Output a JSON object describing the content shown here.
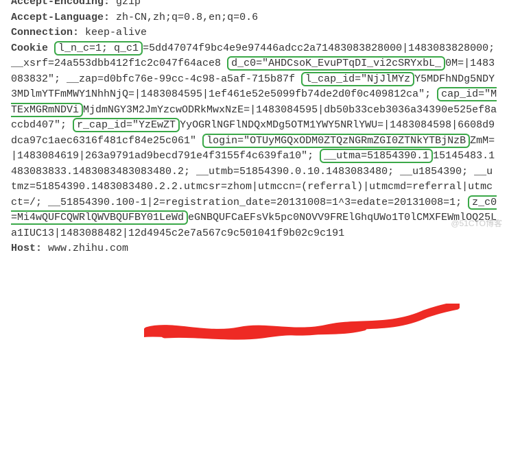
{
  "headers": {
    "accept_encoding_label": "Accept-Encoding:",
    "accept_encoding_value": "gzip",
    "accept_language_label": "Accept-Language:",
    "accept_language_value": "zh-CN,zh;q=0.8,en;q=0.6",
    "connection_label": "Connection:",
    "connection_value": "keep-alive",
    "cookie_label": "Cookie",
    "host_label": "Host:",
    "host_value": "www.zhihu.com"
  },
  "cookie": {
    "hl_lnc": "l_n_c=1; q_c1",
    "seg1": "=5dd47074f9bc4e9e97446adcc2a71483083828000|1483083828000; __xsrf=24a553dbb412f1c2c047f64ace8",
    "hl_dc0": "d_c0=\"AHDCsoK_EvuPTqDI_vi2cSRYxbL_",
    "seg2": "0M=|1483083832\"; __zap=d0bfc76e-99cc-4c98-a5af-715b87f",
    "hl_lcap": "l_cap_id=\"NjJlMYz",
    "seg3": "Y5MDFhNDg5NDY3MDlmYTFmMWY1NhhNjQ=|1483084595|1ef461e52e5099fb74de2d0f0c409812ca\";",
    "hl_cap": "cap_id=\"MTExMGRmNDVi",
    "seg4": "MjdmNGY3M2JmYzcwODRkMwxNzE=|1483084595|db50b33ceb3036a34390e525ef8accbd407\";",
    "hl_rcap": "r_cap_id=\"YzEwZT",
    "seg5": "YyOGRlNGFlNDQxMDg5OTM1YWY5NRlYWU=|1483084598|6608d9dca97c1aec6316f481cf84e25c061\"",
    "hl_login": "login=\"OTUyMGQxODM0ZTQzNGRmZGI0ZTNkYTBjNzB",
    "seg6": "ZmM=|1483084619|263a9791ad9becd791e4f3155f4c639fa10\";",
    "hl_utma": "__utma=51854390.1",
    "seg7": "15145483.1483083833.1483083483083480.2; __utmb=51854390.0.10.1483083480; __u1854390; __utmz=51854390.1483083480.2.2.utmcsr=zhom|utmccn=(referral)|utmcmd=referral|utmcct=/; __51854390.100-1|2=registration_date=20131008=1^3=edate=20131008=1;",
    "hl_zc0": "z_c0=Mi4wQUFCQWRlQWVBQUFBY01LeWd",
    "seg8": "eGNBQUFCaEFsVk5pc0NOVV9FRElGhqUWo1T0lCMXFEWmlOQ25La1IUC13|1483088482|12d4945c2e7a567c9c501041f9b02c9c191"
  },
  "watermark": "@51CTO博客"
}
